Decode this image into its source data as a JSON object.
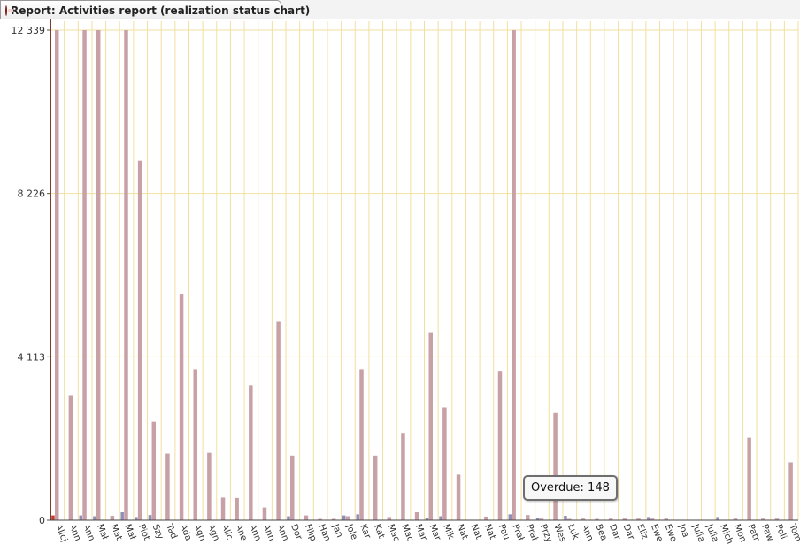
{
  "window": {
    "tab_title": "Report: Activities report (realization status chart)"
  },
  "tooltip": {
    "label": "Overdue",
    "value": "148",
    "text": "Overdue: 148"
  },
  "colors": {
    "bar_main": "#c8a1a7",
    "bar_small": "#8f8fb8",
    "bar_red": "#c0392b",
    "grid": "#f2df9e",
    "axis": "#7a3d28"
  },
  "chart_data": {
    "type": "bar",
    "ylim": [
      0,
      12339
    ],
    "y_ticks": [
      "0",
      "4 113",
      "8 226",
      "12 339"
    ],
    "y_tick_values": [
      0,
      4113,
      8226,
      12339
    ],
    "categories": [
      "Alicj",
      "Ann",
      "Ann",
      "Mał",
      "Mat",
      "Mał",
      "Piot",
      "Szy",
      "Tad",
      "Ada",
      "Agn",
      "Agn",
      "Alic",
      "Ane",
      "Ann",
      "Ann",
      "Ann",
      "Dor",
      "Filip",
      "Han",
      "Jan",
      "Jole",
      "Kar",
      "Kat",
      "Mac",
      "Mac",
      "Mar",
      "Mar",
      "Mik",
      "Nat",
      "Nat",
      "Nat",
      "Pau",
      "Prał",
      "Prał",
      "Przy",
      "Wes",
      "Łuk",
      "Ann",
      "Bea",
      "Dar",
      "Dar",
      "Eliz",
      "Ewe",
      "Ewe",
      "Joa",
      "Julia",
      "Julia",
      "Mich",
      "Mon",
      "Patr",
      "Paw",
      "Poli",
      "Tom"
    ],
    "series": [
      {
        "name": "Overdue",
        "values": [
          120,
          0,
          120,
          100,
          0,
          200,
          80,
          130,
          0,
          0,
          0,
          0,
          0,
          0,
          0,
          0,
          0,
          100,
          0,
          0,
          0,
          120,
          148,
          0,
          0,
          0,
          0,
          60,
          100,
          0,
          0,
          0,
          0,
          148,
          0,
          60,
          0,
          110,
          0,
          0,
          0,
          0,
          0,
          80,
          0,
          0,
          0,
          0,
          80,
          0,
          0,
          0,
          0,
          0
        ]
      },
      {
        "name": "",
        "values": [
          12339,
          3130,
          12339,
          12339,
          110,
          12339,
          9050,
          2480,
          1680,
          5700,
          3800,
          1700,
          570,
          560,
          3400,
          320,
          5000,
          1630,
          120,
          30,
          30,
          100,
          3800,
          1630,
          80,
          2200,
          200,
          4730,
          2840,
          1150,
          0,
          90,
          3760,
          12339,
          130,
          40,
          2700,
          30,
          40,
          30,
          40,
          40,
          40,
          40,
          40,
          0,
          0,
          0,
          0,
          40,
          2080,
          40,
          40,
          1460
        ]
      }
    ]
  }
}
